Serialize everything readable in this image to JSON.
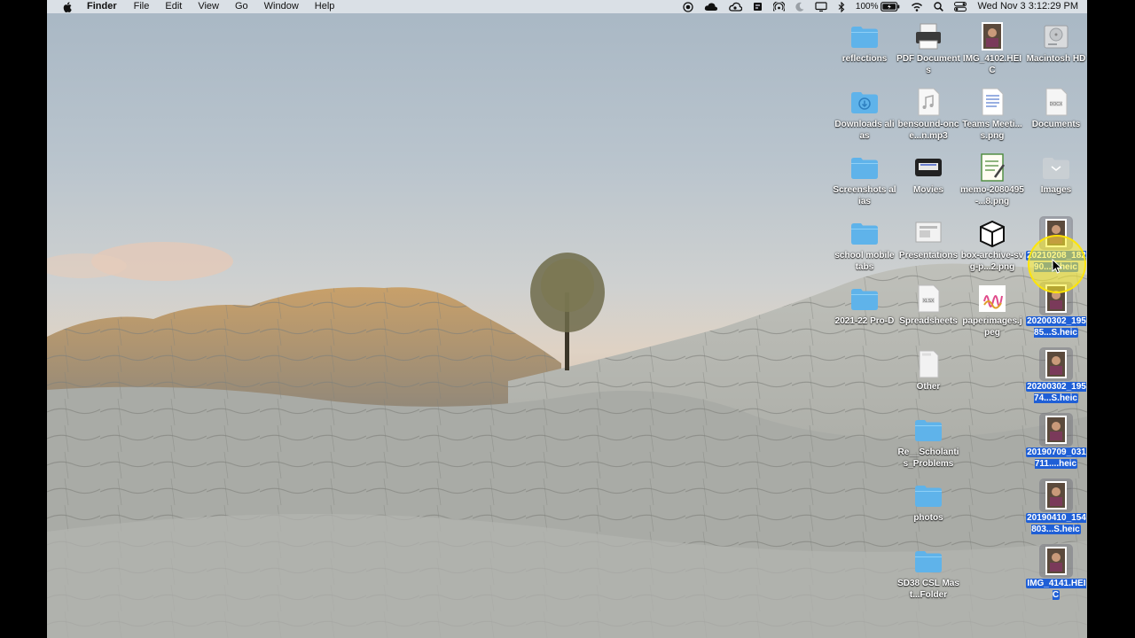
{
  "menubar": {
    "app_name": "Finder",
    "menus": [
      "File",
      "Edit",
      "View",
      "Go",
      "Window",
      "Help"
    ],
    "status_icons": [
      "record-icon",
      "cloud-icon",
      "creative-cloud-icon",
      "dropbox-icon",
      "airdrop-icon",
      "moon-icon",
      "display-icon",
      "bluetooth-icon"
    ],
    "battery_percent": "100%",
    "datetime": "Wed Nov 3  3:12:29 PM"
  },
  "desktop_icons": [
    {
      "label": "reflections",
      "kind": "folder"
    },
    {
      "label": "PDF Documents",
      "kind": "printer"
    },
    {
      "label": "IMG_4102.HEIC",
      "kind": "photo"
    },
    {
      "label": "Macintosh HD",
      "kind": "drive"
    },
    {
      "label": "Downloads alias",
      "kind": "downloads-folder"
    },
    {
      "label": "bensound-once...n.mp3",
      "kind": "audio"
    },
    {
      "label": "Teams Meeti...s.png",
      "kind": "doc"
    },
    {
      "label": "Documents",
      "kind": "docx"
    },
    {
      "label": "Screenshots alias",
      "kind": "folder"
    },
    {
      "label": "Movies",
      "kind": "movie"
    },
    {
      "label": "memo-2080495-...8.png",
      "kind": "memo"
    },
    {
      "label": "Images",
      "kind": "empty-folder"
    },
    {
      "label": "school mobile tabs",
      "kind": "folder"
    },
    {
      "label": "Presentations",
      "kind": "presentation"
    },
    {
      "label": "box-archive-svg-p...2.png",
      "kind": "box"
    },
    {
      "label": "20210208_18290...S.heic",
      "kind": "photo",
      "selected": true
    },
    {
      "label": "2021-22 Pro-D",
      "kind": "folder"
    },
    {
      "label": "Spreadsheets",
      "kind": "spreadsheet"
    },
    {
      "label": "paperimages.jpeg",
      "kind": "paper"
    },
    {
      "label": "20200302_19585...S.heic",
      "kind": "photo",
      "selected": true
    },
    {
      "label": "Other",
      "kind": "other"
    },
    {
      "label": "20200302_19574...S.heic",
      "kind": "photo",
      "selected": true
    },
    {
      "label": "Re__Scholantis_Problems",
      "kind": "folder"
    },
    {
      "label": "20190709_031711....heic",
      "kind": "photo",
      "selected": true
    },
    {
      "label": "photos",
      "kind": "folder"
    },
    {
      "label": "20190410_154803...S.heic",
      "kind": "photo",
      "selected": true
    },
    {
      "label": "SD38 CSL Mast...Folder",
      "kind": "folder"
    },
    {
      "label": "IMG_4141.HEIC",
      "kind": "photo",
      "selected": true
    }
  ],
  "colors": {
    "folder": "#5fb3ea",
    "selection": "#1f5fd6",
    "highlight": "#fff028"
  }
}
